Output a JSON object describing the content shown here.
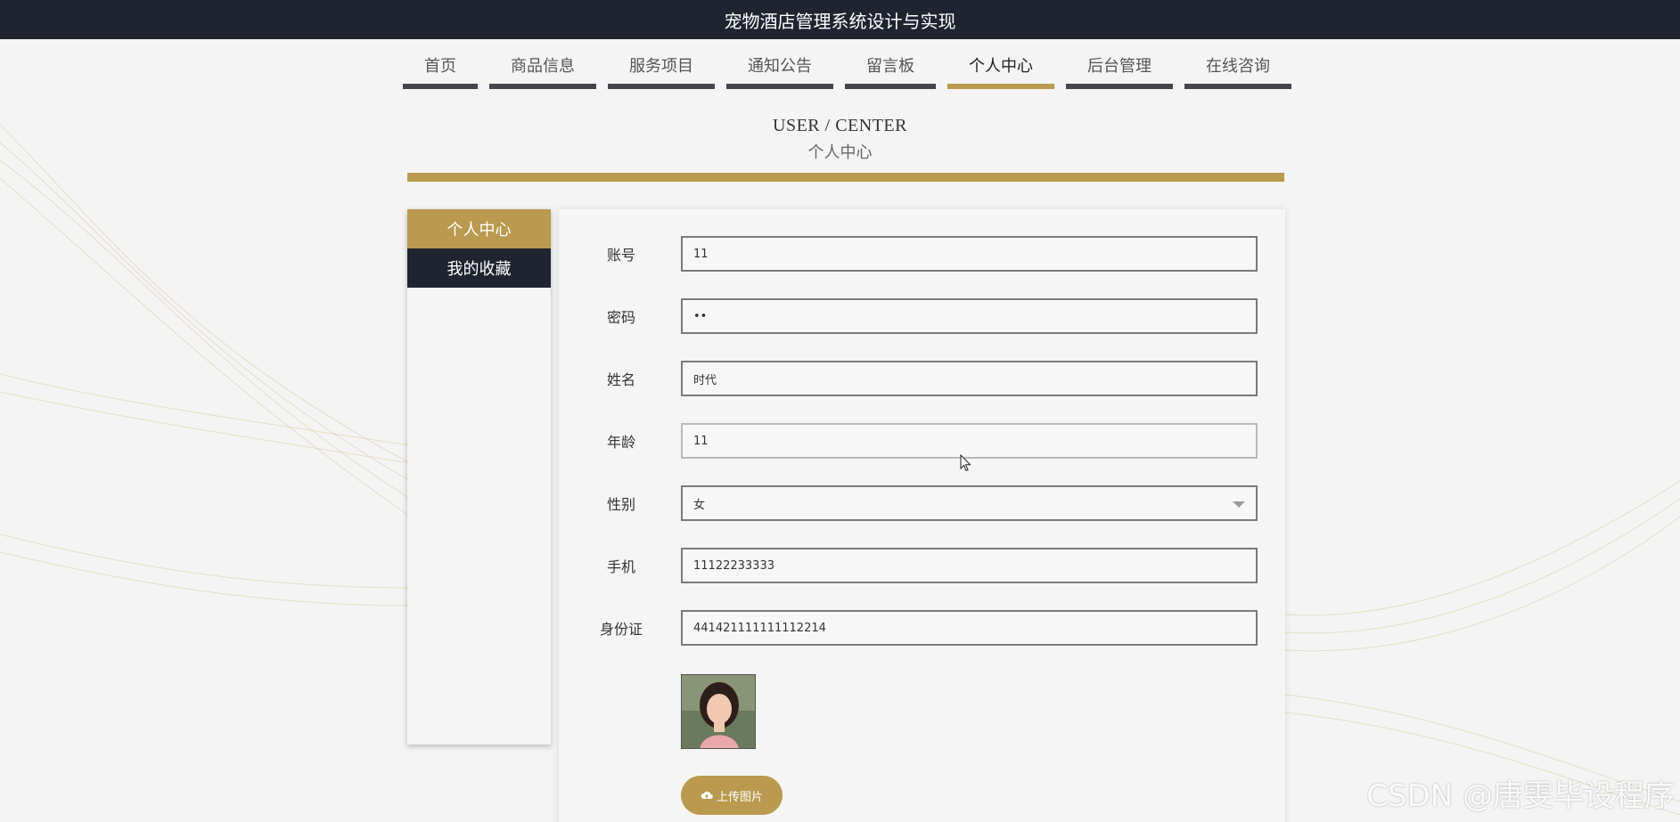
{
  "app": {
    "title": "宠物酒店管理系统设计与实现"
  },
  "nav": {
    "items": [
      {
        "label": "首页"
      },
      {
        "label": "商品信息"
      },
      {
        "label": "服务项目"
      },
      {
        "label": "通知公告"
      },
      {
        "label": "留言板"
      },
      {
        "label": "个人中心",
        "active": true
      },
      {
        "label": "后台管理"
      },
      {
        "label": "在线咨询"
      }
    ]
  },
  "section": {
    "title_en": "USER / CENTER",
    "title_zh": "个人中心"
  },
  "sidebar": {
    "items": [
      {
        "label": "个人中心",
        "active": true
      },
      {
        "label": "我的收藏"
      }
    ]
  },
  "form": {
    "account": {
      "label": "账号",
      "value": "11"
    },
    "password": {
      "label": "密码",
      "value": "••"
    },
    "name": {
      "label": "姓名",
      "value": "时代"
    },
    "age": {
      "label": "年龄",
      "value": "11"
    },
    "gender": {
      "label": "性别",
      "value": "女"
    },
    "phone": {
      "label": "手机",
      "value": "11122233333"
    },
    "id_card": {
      "label": "身份证",
      "value": "441421111111112214"
    },
    "avatar": {
      "description": "user-photo"
    },
    "upload_label": "上传图片"
  },
  "watermark": "CSDN @唐雯毕设程序",
  "colors": {
    "accent": "#b99a4e",
    "dark": "#1f2430",
    "background": "#f4f4f4"
  }
}
